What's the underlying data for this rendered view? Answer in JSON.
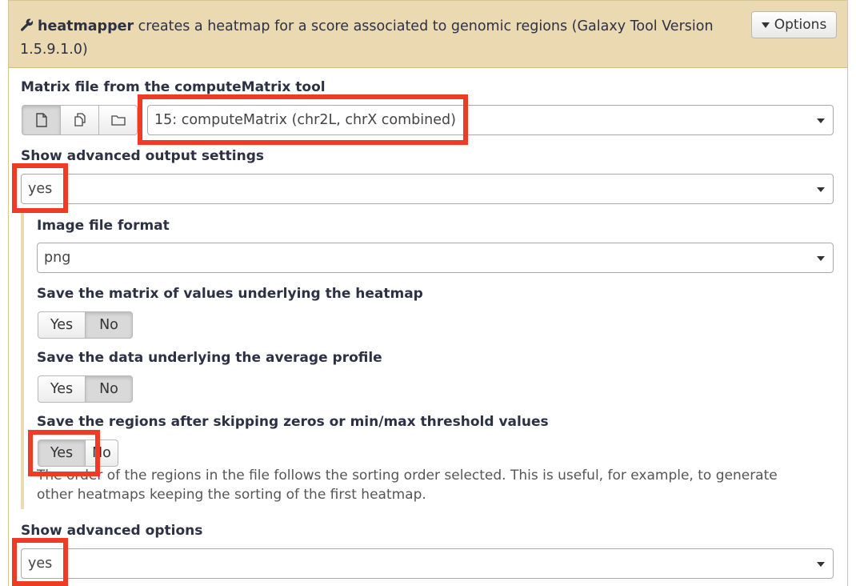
{
  "header": {
    "tool_name": "heatmapper",
    "description": " creates a heatmap for a score associated to genomic regions (Galaxy Tool Version 1.5.9.1.0)",
    "options_label": "Options",
    "wrench_icon": "wrench-icon"
  },
  "matrix": {
    "label": "Matrix file from the computeMatrix tool",
    "selected": "15: computeMatrix (chr2L, chrX combined)",
    "source_buttons": [
      "single-dataset-icon",
      "multiple-datasets-icon",
      "dataset-collection-icon"
    ]
  },
  "advanced_output": {
    "label": "Show advanced output settings",
    "selected": "yes"
  },
  "image_format": {
    "label": "Image file format",
    "selected": "png"
  },
  "save_matrix": {
    "label": "Save the matrix of values underlying the heatmap",
    "yes": "Yes",
    "no": "No",
    "value": "No"
  },
  "save_profile": {
    "label": "Save the data underlying the average profile",
    "yes": "Yes",
    "no": "No",
    "value": "No"
  },
  "save_regions": {
    "label": "Save the regions after skipping zeros or min/max threshold values",
    "yes": "Yes",
    "no": "No",
    "value": "Yes",
    "help": "The order of the regions in the file follows the sorting order selected. This is useful, for example, to generate other heatmaps keeping the sorting of the first heatmap."
  },
  "advanced_options": {
    "label": "Show advanced options",
    "selected": "yes"
  },
  "colors": {
    "header_bg": "#ebd9b2",
    "highlight": "#ee3b26"
  }
}
